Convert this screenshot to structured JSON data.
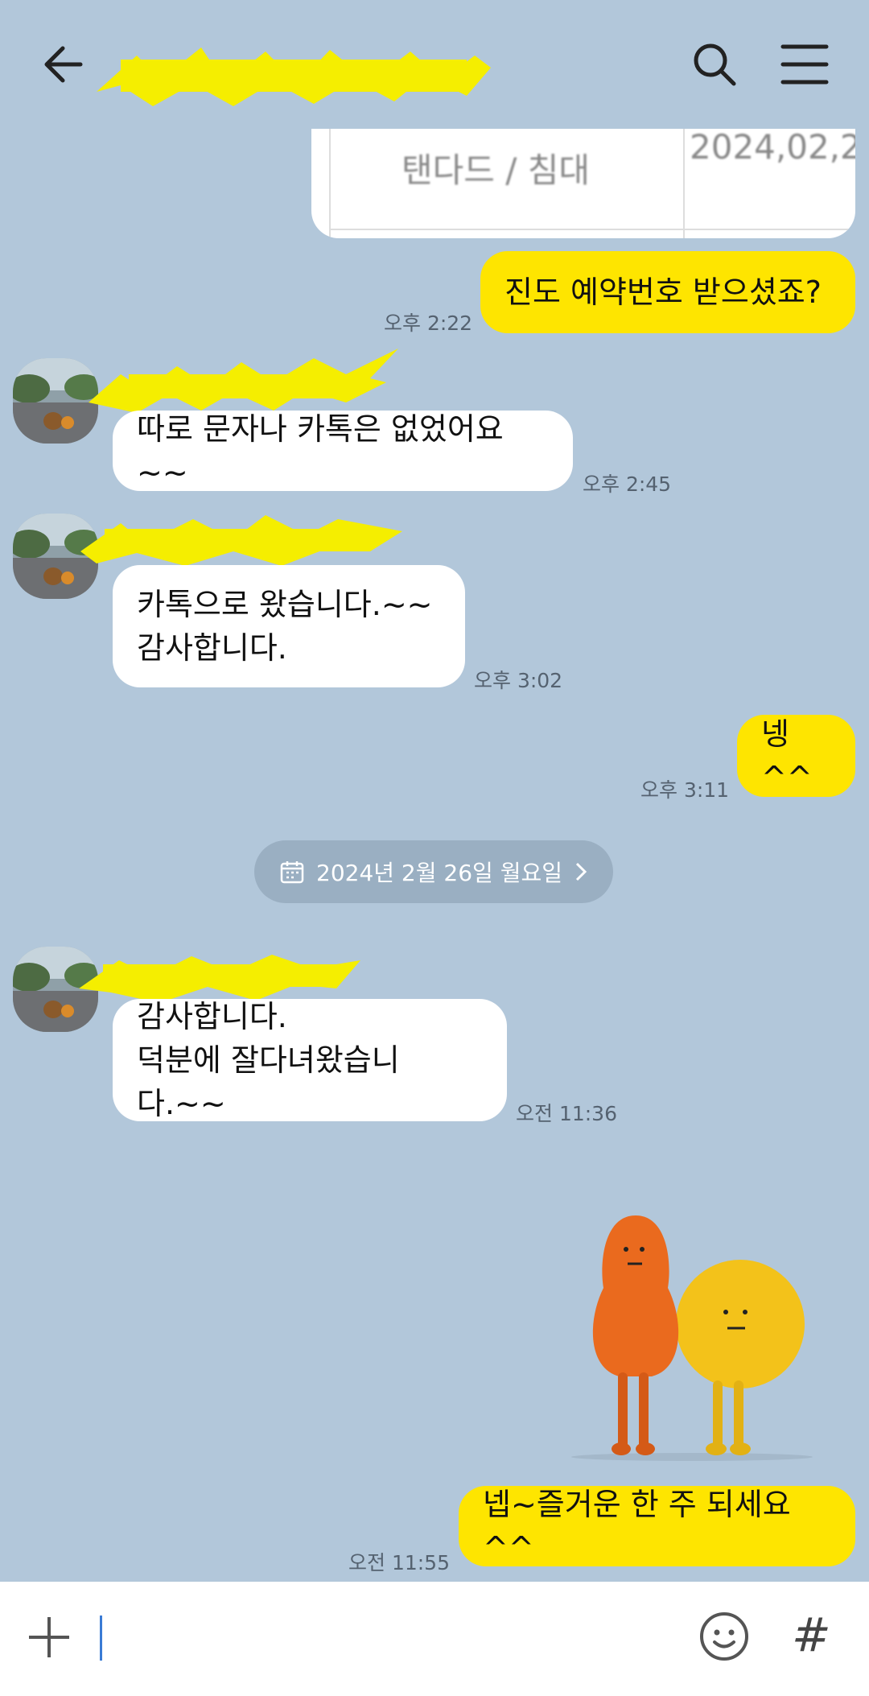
{
  "header": {
    "title": "",
    "back_icon": "arrow-left-icon",
    "search_icon": "search-icon",
    "menu_icon": "hamburger-menu-icon"
  },
  "card": {
    "cell_left": "탠다드 / 침대",
    "cell_right": "2024,02,2"
  },
  "messages": [
    {
      "side": "me",
      "text": "진도 예약번호 받으셨죠?",
      "time": "오후 2:22"
    },
    {
      "side": "them",
      "text": "따로 문자나 카톡은 없었어요~~",
      "time": "오후 2:45"
    },
    {
      "side": "them",
      "text": "카톡으로 왔습니다.~~\n감사합니다.",
      "time": "오후 3:02"
    },
    {
      "side": "me",
      "text": "넹^^",
      "time": "오후 3:11"
    },
    {
      "side": "them",
      "text": "감사합니다.\n덕분에 잘다녀왔습니다.~~",
      "time": "오전 11:36"
    },
    {
      "side": "me",
      "text": "넵~즐거운 한 주 되세요^^",
      "time": "오전 11:55"
    }
  ],
  "date_divider": {
    "label": "2024년 2월 26일 월요일",
    "icon": "calendar-icon"
  },
  "input": {
    "placeholder": "",
    "plus_icon": "plus-icon",
    "emoji_icon": "emoji-icon",
    "hash_label": "#"
  },
  "colors": {
    "background": "#b2c7da",
    "my_bubble": "#fee500",
    "their_bubble": "#ffffff",
    "redaction": "#f5ee00"
  }
}
